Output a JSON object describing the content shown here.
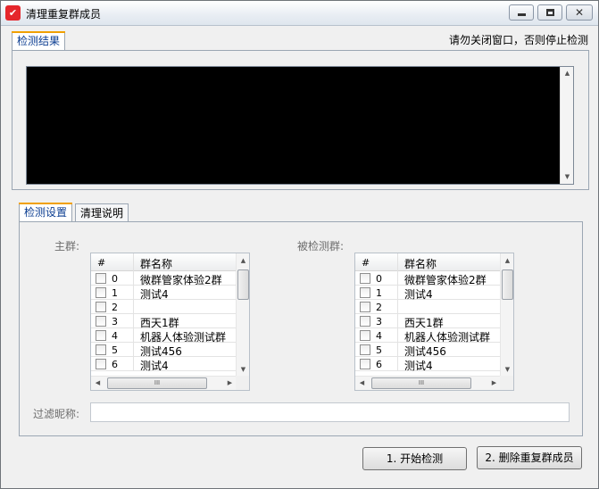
{
  "window": {
    "title": "清理重复群成员",
    "icon_color": "#e5262b"
  },
  "top_tabs": [
    {
      "label": "检测结果",
      "active": true
    }
  ],
  "hint": "请勿关闭窗口，否则停止检测",
  "bottom_tabs": [
    {
      "label": "检测设置",
      "active": true
    },
    {
      "label": "清理说明",
      "active": false
    }
  ],
  "settings": {
    "main_group_label": "主群:",
    "checked_group_label": "被检测群:",
    "filter_label": "过滤昵称:",
    "filter_value": "",
    "grid_columns": {
      "num": "#",
      "name": "群名称"
    },
    "main_grid_rows": [
      {
        "idx": "0",
        "name": "微群管家体验2群"
      },
      {
        "idx": "1",
        "name": "测试4"
      },
      {
        "idx": "2",
        "name": ""
      },
      {
        "idx": "3",
        "name": "西天1群"
      },
      {
        "idx": "4",
        "name": "机器人体验测试群"
      },
      {
        "idx": "5",
        "name": "测试456"
      },
      {
        "idx": "6",
        "name": "测试4"
      }
    ],
    "checked_grid_rows": [
      {
        "idx": "0",
        "name": "微群管家体验2群"
      },
      {
        "idx": "1",
        "name": "测试4"
      },
      {
        "idx": "2",
        "name": ""
      },
      {
        "idx": "3",
        "name": "西天1群"
      },
      {
        "idx": "4",
        "name": "机器人体验测试群"
      },
      {
        "idx": "5",
        "name": "测试456"
      },
      {
        "idx": "6",
        "name": "测试4"
      }
    ]
  },
  "buttons": {
    "start": "1. 开始检测",
    "delete": "2. 删除重复群成员"
  },
  "icons": {
    "scroll_up": "▲",
    "scroll_down": "▼",
    "scroll_left": "◀",
    "scroll_right": "▶",
    "grip": "III"
  }
}
